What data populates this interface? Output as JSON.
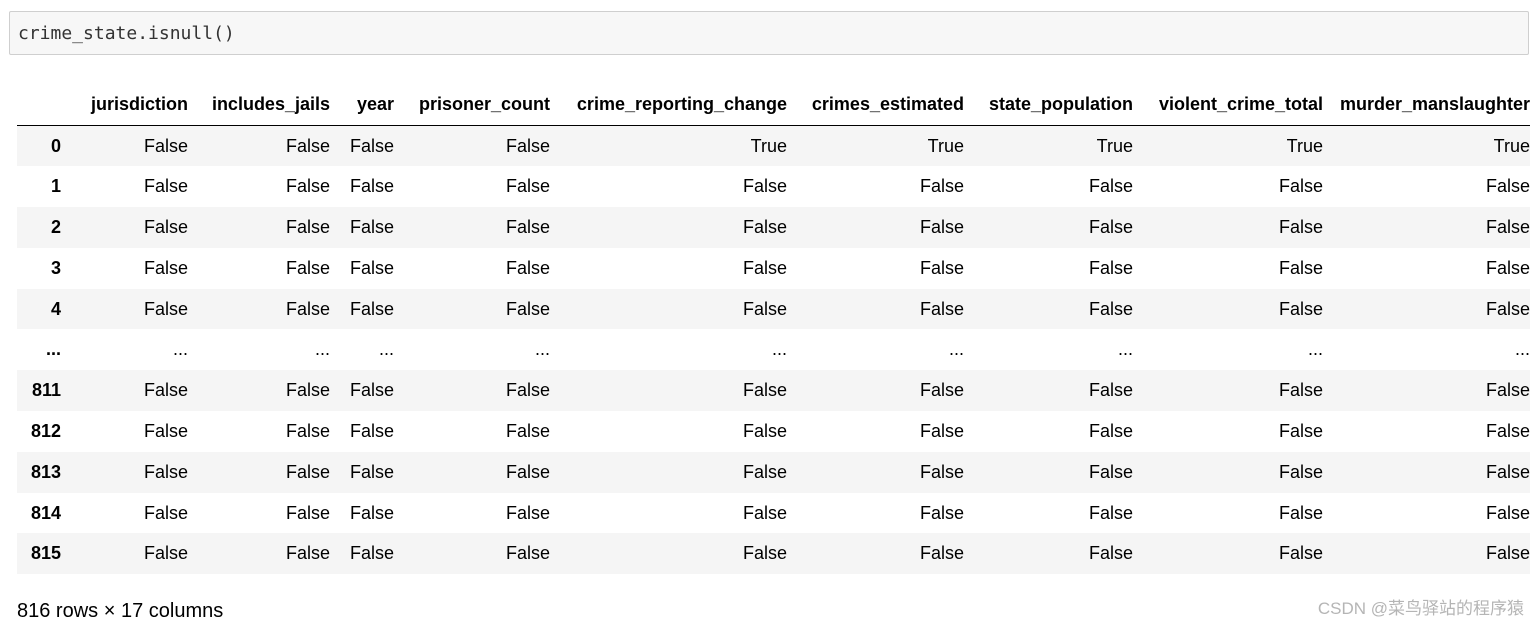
{
  "code_cell": {
    "code": "crime_state.isnull()"
  },
  "dataframe": {
    "columns": [
      "",
      "jurisdiction",
      "includes_jails",
      "year",
      "prisoner_count",
      "crime_reporting_change",
      "crimes_estimated",
      "state_population",
      "violent_crime_total",
      "murder_manslaughter"
    ],
    "rows": [
      {
        "index": "0",
        "values": [
          "False",
          "False",
          "False",
          "False",
          "True",
          "True",
          "True",
          "True",
          "True"
        ]
      },
      {
        "index": "1",
        "values": [
          "False",
          "False",
          "False",
          "False",
          "False",
          "False",
          "False",
          "False",
          "False"
        ]
      },
      {
        "index": "2",
        "values": [
          "False",
          "False",
          "False",
          "False",
          "False",
          "False",
          "False",
          "False",
          "False"
        ]
      },
      {
        "index": "3",
        "values": [
          "False",
          "False",
          "False",
          "False",
          "False",
          "False",
          "False",
          "False",
          "False"
        ]
      },
      {
        "index": "4",
        "values": [
          "False",
          "False",
          "False",
          "False",
          "False",
          "False",
          "False",
          "False",
          "False"
        ]
      },
      {
        "index": "...",
        "values": [
          "...",
          "...",
          "...",
          "...",
          "...",
          "...",
          "...",
          "...",
          "..."
        ]
      },
      {
        "index": "811",
        "values": [
          "False",
          "False",
          "False",
          "False",
          "False",
          "False",
          "False",
          "False",
          "False"
        ]
      },
      {
        "index": "812",
        "values": [
          "False",
          "False",
          "False",
          "False",
          "False",
          "False",
          "False",
          "False",
          "False"
        ]
      },
      {
        "index": "813",
        "values": [
          "False",
          "False",
          "False",
          "False",
          "False",
          "False",
          "False",
          "False",
          "False"
        ]
      },
      {
        "index": "814",
        "values": [
          "False",
          "False",
          "False",
          "False",
          "False",
          "False",
          "False",
          "False",
          "False"
        ]
      },
      {
        "index": "815",
        "values": [
          "False",
          "False",
          "False",
          "False",
          "False",
          "False",
          "False",
          "False",
          "False"
        ]
      }
    ],
    "shape_text": "816 rows × 17 columns"
  },
  "watermark": "CSDN @菜鸟驿站的程序猿"
}
